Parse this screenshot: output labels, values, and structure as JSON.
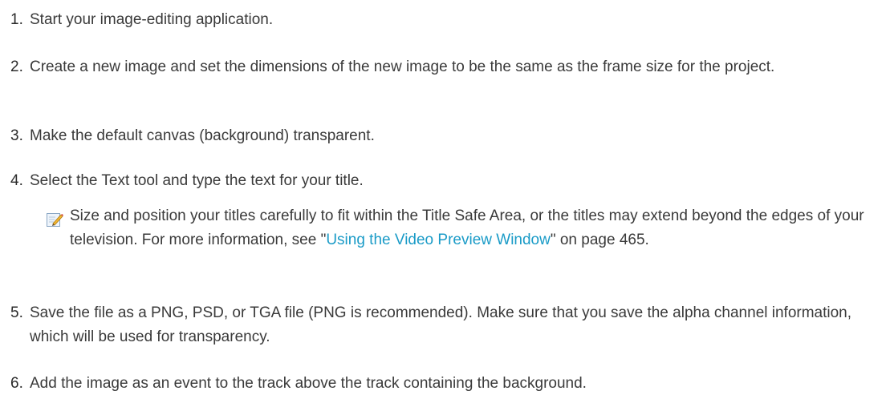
{
  "steps": [
    {
      "number": "1.",
      "text": "Start your image-editing application."
    },
    {
      "number": "2.",
      "text": "Create a new image and set the dimensions of the new image to be the same as the frame size for the project."
    },
    {
      "number": "3.",
      "text": "Make the default canvas (background) transparent."
    },
    {
      "number": "4.",
      "text": "Select the Text tool and type the text for your title."
    },
    {
      "number": "5.",
      "text": "Save the file as a PNG, PSD, or TGA file (PNG is recommended). Make sure that you save the alpha channel information, which will be used for transparency."
    },
    {
      "number": "6.",
      "text": "Add the image as an event to the track above the track containing the background."
    }
  ],
  "note": {
    "icon": "note-pencil-icon",
    "text_before": "Size and position your titles carefully to fit within the Title Safe Area, or the titles may extend beyond the edges of your television. For more information, see \"",
    "link_text": "Using the Video Preview Window",
    "text_after": "\" on page 465."
  },
  "colors": {
    "text": "#3a3a3a",
    "link": "#1a9bc7"
  }
}
